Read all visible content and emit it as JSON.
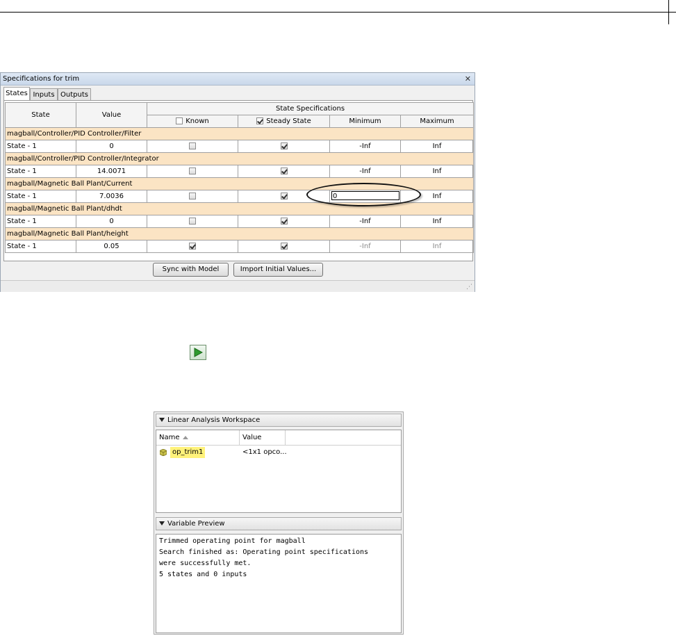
{
  "dialog": {
    "title": "Specifications for trim",
    "close_glyph": "✕",
    "tabs": [
      {
        "label": "States",
        "active": true
      },
      {
        "label": "Inputs",
        "active": false
      },
      {
        "label": "Outputs",
        "active": false
      }
    ],
    "headers": {
      "state": "State",
      "value": "Value",
      "specs_group": "State Specifications",
      "known": "Known",
      "steady_state": "Steady State",
      "minimum": "Minimum",
      "maximum": "Maximum"
    },
    "groups": [
      {
        "name": "magball/Controller/PID Controller/Filter",
        "row": {
          "state": "State - 1",
          "value": "0",
          "known": false,
          "steady": true,
          "min": "-Inf",
          "max": "Inf",
          "dim_limits": false
        }
      },
      {
        "name": "magball/Controller/PID Controller/Integrator",
        "row": {
          "state": "State - 1",
          "value": "14.0071",
          "known": false,
          "steady": true,
          "min": "-Inf",
          "max": "Inf",
          "dim_limits": false
        }
      },
      {
        "name": "magball/Magnetic Ball Plant/Current",
        "row": {
          "state": "State - 1",
          "value": "7.0036",
          "known": false,
          "steady": true,
          "min": "0",
          "max": "Inf",
          "dim_limits": false,
          "editing_min": true
        }
      },
      {
        "name": "magball/Magnetic Ball Plant/dhdt",
        "row": {
          "state": "State - 1",
          "value": "0",
          "known": false,
          "steady": true,
          "min": "-Inf",
          "max": "Inf",
          "dim_limits": false
        }
      },
      {
        "name": "magball/Magnetic Ball Plant/height",
        "row": {
          "state": "State - 1",
          "value": "0.05",
          "known": true,
          "steady": true,
          "min": "-Inf",
          "max": "Inf",
          "dim_limits": true
        }
      }
    ],
    "buttons": {
      "sync": "Sync with Model",
      "import": "Import Initial Values..."
    }
  },
  "workspace": {
    "title": "Linear Analysis Workspace",
    "columns": {
      "name": "Name",
      "value": "Value"
    },
    "variables": [
      {
        "name": "op_trim1",
        "value": "<1x1 opco..."
      }
    ]
  },
  "preview": {
    "title": "Variable Preview",
    "lines": [
      "Trimmed operating point for magball",
      "Search finished as: Operating point specifications",
      "were successfully met.",
      "5 states and 0 inputs"
    ]
  },
  "colors": {
    "group_row": "#fbe4c4",
    "highlight": "#fff27a",
    "run_green": "#2e9a2e"
  }
}
